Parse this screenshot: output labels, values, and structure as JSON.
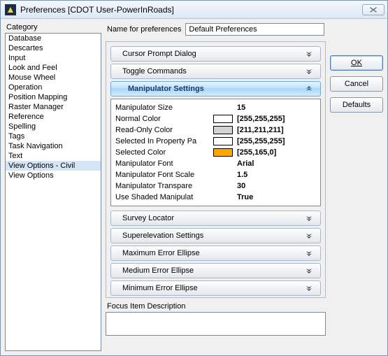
{
  "window": {
    "title": "Preferences [CDOT User-PowerInRoads]"
  },
  "category": {
    "label": "Category",
    "items": [
      "Database",
      "Descartes",
      "Input",
      "Look and Feel",
      "Mouse Wheel",
      "Operation",
      "Position Mapping",
      "Raster Manager",
      "Reference",
      "Spelling",
      "Tags",
      "Task Navigation",
      "Text",
      "View Options - Civil",
      "View Options"
    ],
    "selected_index": 13
  },
  "pref_name": {
    "label": "Name for preferences",
    "value": "Default Preferences"
  },
  "sections": {
    "cursor_prompt": "Cursor Prompt Dialog",
    "toggle_commands": "Toggle Commands",
    "manipulator": {
      "title": "Manipulator Settings",
      "rows": {
        "size": {
          "k": "Manipulator Size",
          "v": "15"
        },
        "normal_color": {
          "k": "Normal Color",
          "v": "[255,255,255]",
          "swatch": "#ffffff"
        },
        "readonly_color": {
          "k": "Read-Only Color",
          "v": "[211,211,211]",
          "swatch": "#d3d3d3"
        },
        "selprop_color": {
          "k": "Selected In Property Pa",
          "v": "[255,255,255]",
          "swatch": "#ffffff"
        },
        "selected_color": {
          "k": "Selected Color",
          "v": "[255,165,0]",
          "swatch": "#ffa500"
        },
        "font": {
          "k": "Manipulator Font",
          "v": "Arial"
        },
        "font_scale": {
          "k": "Manipulator Font Scale",
          "v": "1.5"
        },
        "transparency": {
          "k": "Manipulator Transpare",
          "v": "30"
        },
        "shaded": {
          "k": "Use Shaded Manipulat",
          "v": "True"
        }
      }
    },
    "survey_locator": "Survey Locator",
    "superelevation": "Superelevation Settings",
    "max_err": "Maximum Error Ellipse",
    "med_err": "Medium Error Ellipse",
    "min_err": "Minimum Error Ellipse"
  },
  "focus": {
    "label": "Focus Item Description"
  },
  "buttons": {
    "ok": "OK",
    "cancel": "Cancel",
    "defaults": "Defaults"
  }
}
